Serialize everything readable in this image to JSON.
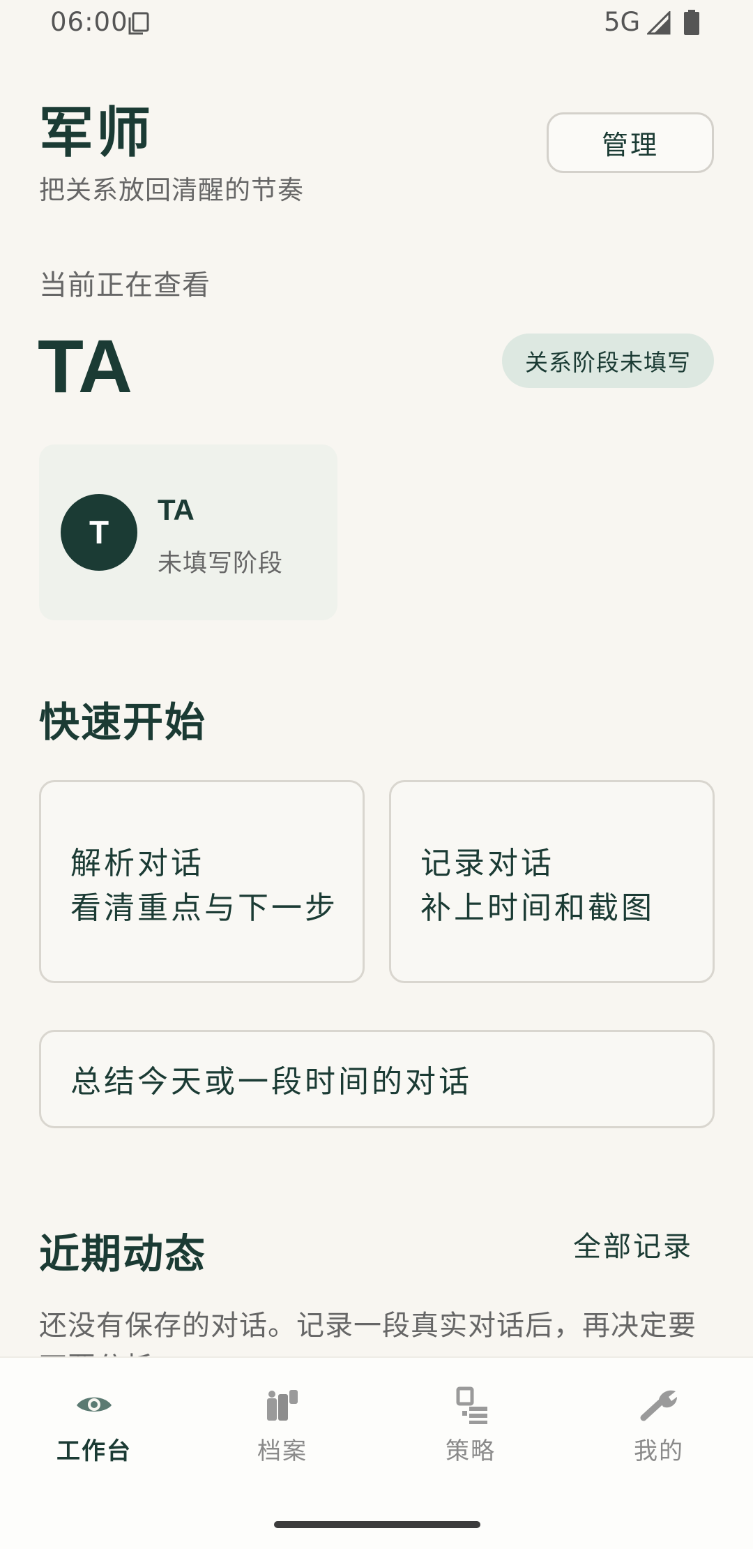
{
  "status_bar": {
    "time": "06:00",
    "network": "5G",
    "icons": [
      "document-icon",
      "signal-icon",
      "battery-icon"
    ]
  },
  "header": {
    "title": "军师",
    "subtitle": "把关系放回清醒的节奏",
    "manage_label": "管理"
  },
  "current": {
    "label": "当前正在查看",
    "name": "TA",
    "stage_badge": "关系阶段未填写"
  },
  "profile_card": {
    "avatar_letter": "T",
    "name": "TA",
    "stage": "未填写阶段"
  },
  "quick_start": {
    "title": "快速开始",
    "analyze": {
      "line1": "解析对话",
      "line2": "看清重点与下一步"
    },
    "record": {
      "line1": "记录对话",
      "line2": "补上时间和截图"
    },
    "summary": "总结今天或一段时间的对话"
  },
  "recent": {
    "title": "近期动态",
    "all_records": "全部记录",
    "empty_line1": "还没有保存的对话。记录一段真实对话后，再决定要",
    "empty_line2": "不要分析。"
  },
  "bottom_nav": {
    "items": [
      {
        "label": "工作台",
        "icon": "eye-icon",
        "active": true
      },
      {
        "label": "档案",
        "icon": "people-icon",
        "active": false
      },
      {
        "label": "策略",
        "icon": "strategy-icon",
        "active": false
      },
      {
        "label": "我的",
        "icon": "wrench-icon",
        "active": false
      }
    ]
  },
  "colors": {
    "background": "#f8f6f1",
    "primary": "#1b3b34",
    "badge_bg": "#dde8e1",
    "card_bg": "#eff2ec",
    "muted_text": "#666666",
    "inactive_nav": "#8a8a8a"
  }
}
